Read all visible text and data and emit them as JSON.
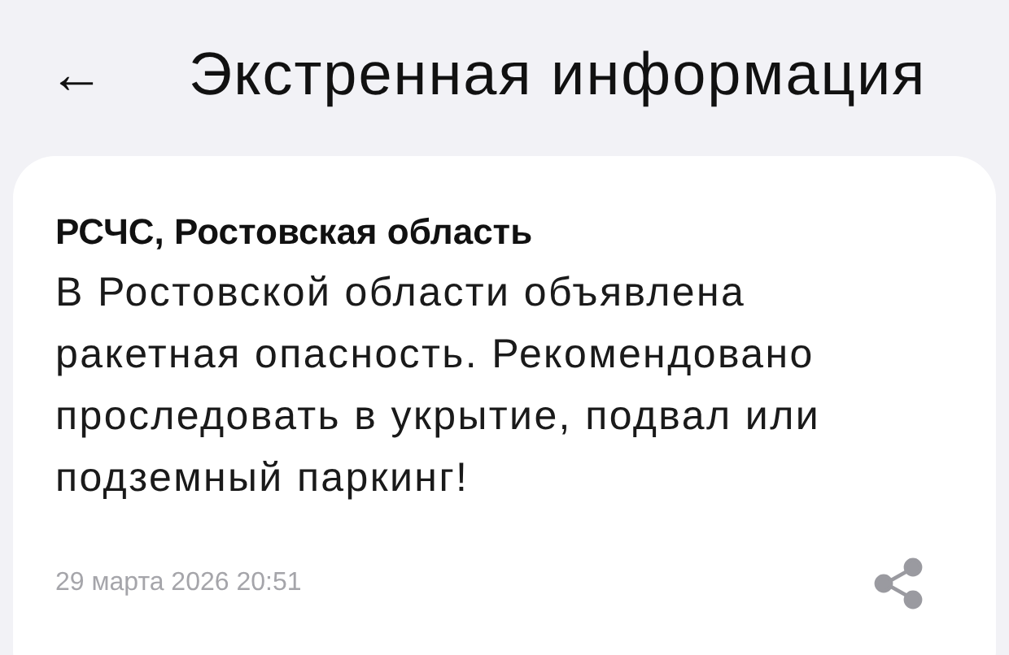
{
  "header": {
    "back_icon": "←",
    "title": "Экстренная информация"
  },
  "message": {
    "sender": "РСЧС, Ростовская область",
    "text": "В Ростовской области объявлена ракетная опасность. Рекомендовано проследовать в укрытие, подвал или подземный паркинг!",
    "date": "29 марта 2026 20:51"
  }
}
